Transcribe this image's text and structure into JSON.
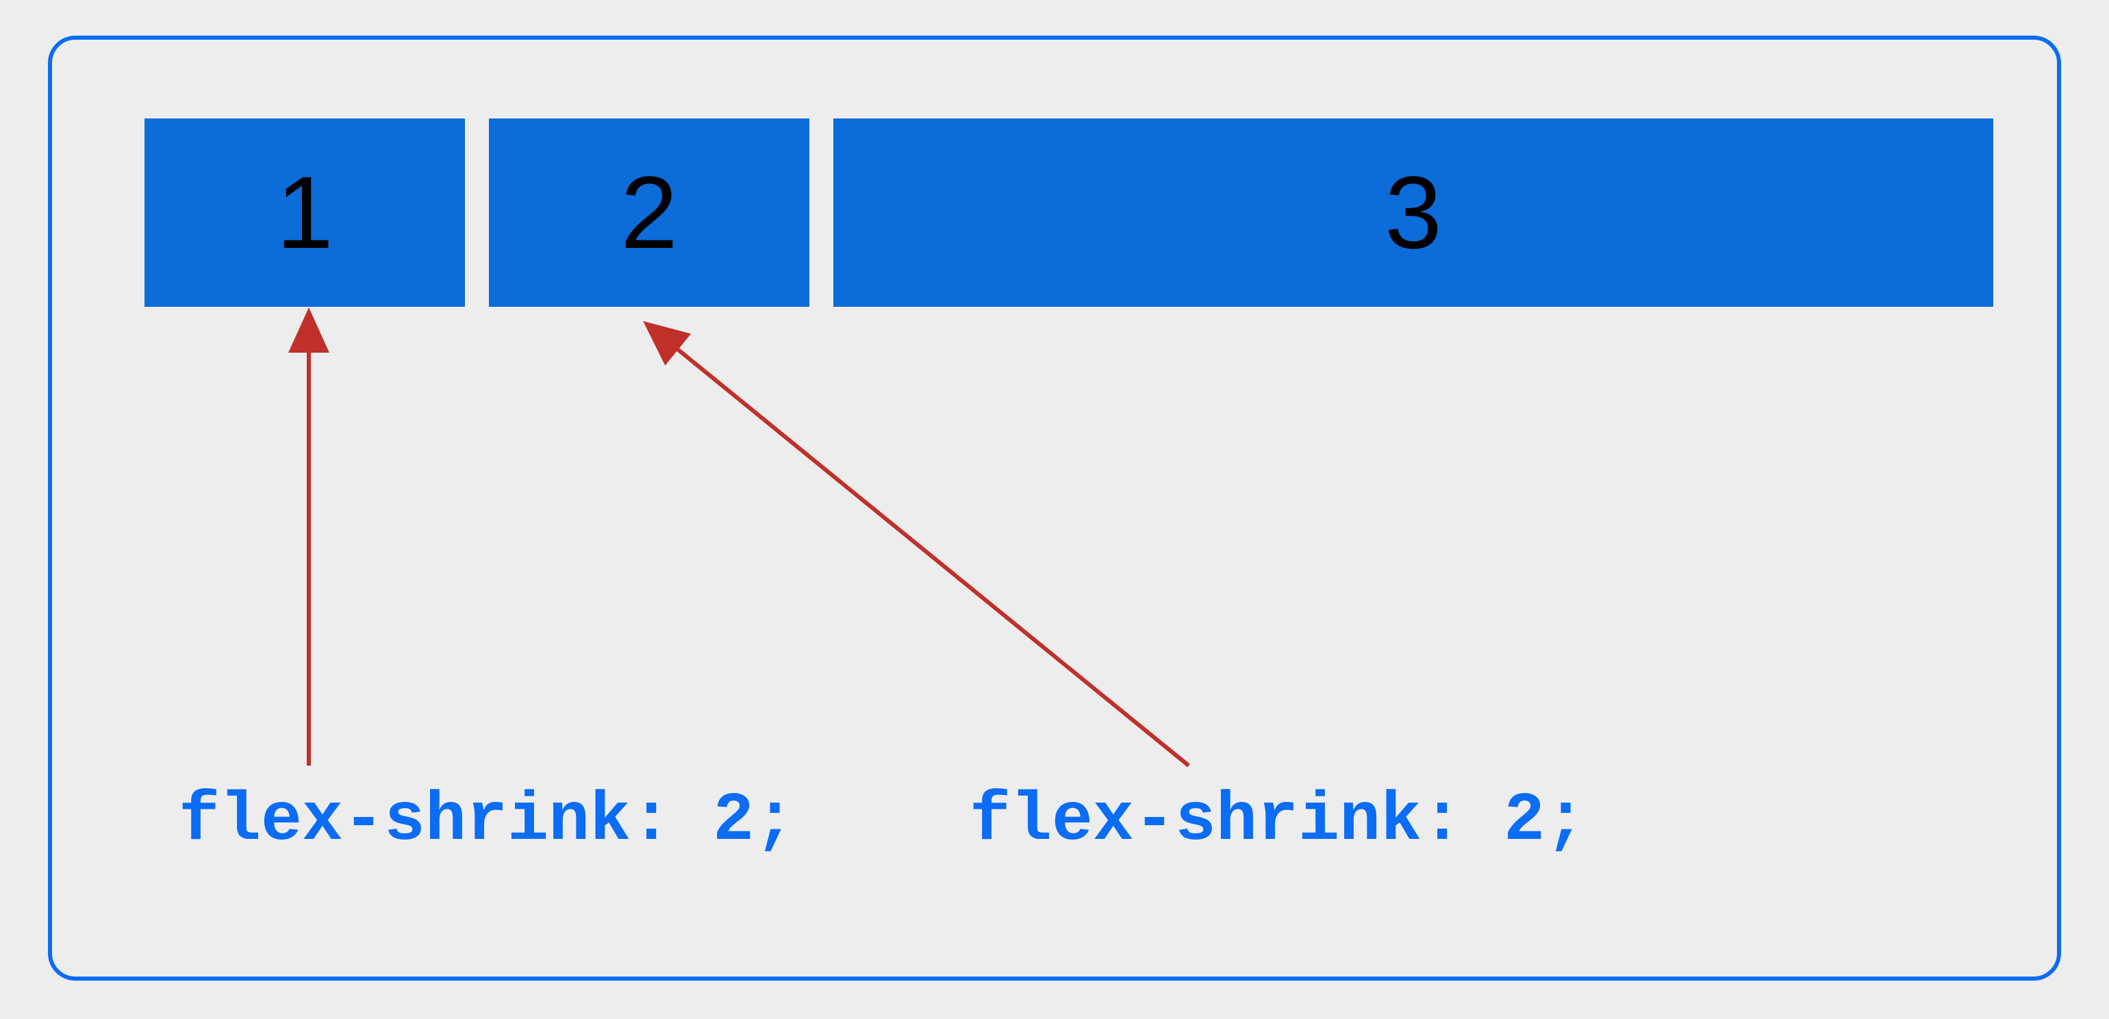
{
  "diagram": {
    "description": "CSS flexbox flex-shrink property illustration",
    "items": [
      {
        "label": "1",
        "property": "flex-shrink: 2;"
      },
      {
        "label": "2",
        "property": "flex-shrink: 2;"
      },
      {
        "label": "3",
        "property": ""
      }
    ],
    "annotations": [
      {
        "text": "flex-shrink: 2;"
      },
      {
        "text": "flex-shrink: 2;"
      }
    ],
    "colors": {
      "border": "#0b6cf5",
      "box_fill": "#0b6cda",
      "arrow": "#c0302a",
      "label_text": "#0b6cf5",
      "background": "#ededed"
    }
  }
}
